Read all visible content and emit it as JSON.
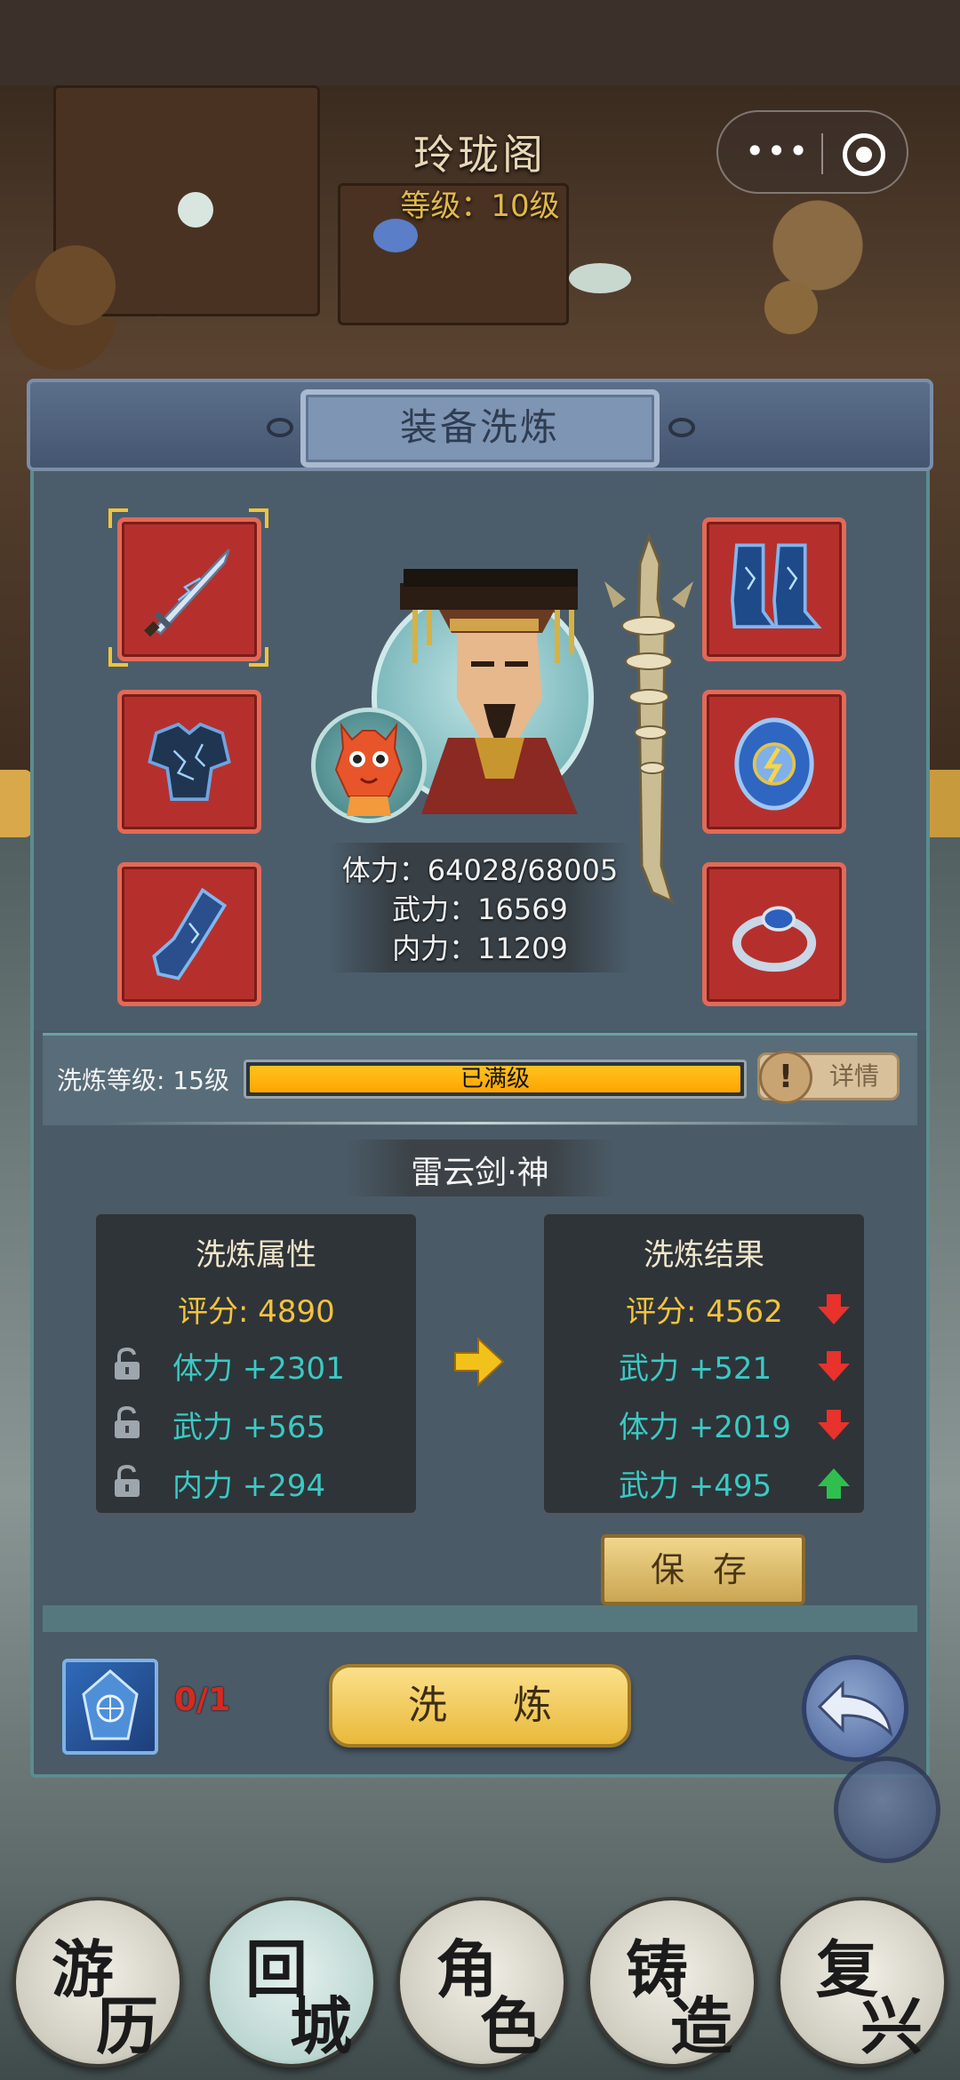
{
  "shop": {
    "title": "玲珑阁",
    "level": "等级：10级"
  },
  "capsule": {
    "more_icon": "more-dots-icon",
    "close_icon": "target-close-icon",
    "dots": "•••"
  },
  "panel": {
    "title": "装备洗炼"
  },
  "equipment": {
    "left_slots": [
      "sword-icon",
      "armor-icon",
      "gauntlet-icon"
    ],
    "right_slots": [
      "boots-icon",
      "amulet-icon",
      "ring-icon"
    ],
    "selected_slot": "sword-icon"
  },
  "character": {
    "hp": "体力：64028/68005",
    "atk": "武力：16569",
    "inner": "内力：11209"
  },
  "refine": {
    "level_label": "洗炼等级: 15级",
    "progress_text": "已满级",
    "progress_fraction": 1.0,
    "detail_label": "详情",
    "detail_icon": "!"
  },
  "item_name": "雷云剑·神",
  "current": {
    "title": "洗炼属性",
    "score": "评分: 4890",
    "attrs": [
      "体力 +2301",
      "武力 +565",
      "内力 +294"
    ]
  },
  "result": {
    "title": "洗炼结果",
    "score": "评分: 4562",
    "score_trend": "down",
    "attrs": [
      {
        "text": "武力 +521",
        "trend": "down"
      },
      {
        "text": "体力 +2019",
        "trend": "down"
      },
      {
        "text": "武力 +495",
        "trend": "up"
      }
    ]
  },
  "save_label": "保  存",
  "material": {
    "count": "0/1",
    "icon": "refine-stone-icon"
  },
  "refine_button": "洗 炼",
  "nav": [
    {
      "top": "游",
      "bottom": "历"
    },
    {
      "top": "回",
      "bottom": "城"
    },
    {
      "top": "角",
      "bottom": "色"
    },
    {
      "top": "铸",
      "bottom": "造"
    },
    {
      "top": "复",
      "bottom": "兴"
    }
  ],
  "colors": {
    "slot_red": "#b5302c",
    "attr_cyan": "#3bc9c4",
    "score_gold": "#f2c33c",
    "down_red": "#e8322b",
    "up_green": "#2fbf4f"
  }
}
